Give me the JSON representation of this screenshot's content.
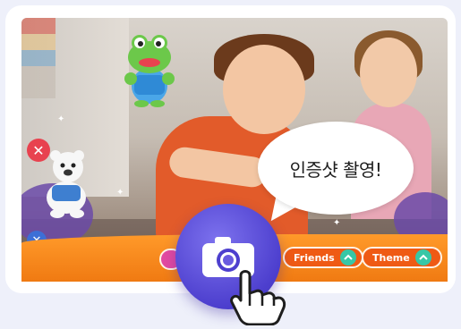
{
  "speech_bubble": {
    "text": "인증샷 촬영!"
  },
  "bottom_bar": {
    "friends_label": "Friends",
    "theme_label": "Theme"
  },
  "icons": {
    "camera": "camera-icon",
    "hand": "pointing-hand-icon",
    "close_red": "close-icon",
    "close_blue": "close-icon",
    "chevron": "chevron-up-icon"
  },
  "colors": {
    "accent_orange": "#f07a12",
    "camera_purple": "#4d3fce",
    "chevron_teal": "#37c7a6",
    "delete_red": "#e8424f",
    "delete_blue": "#3d6fd6"
  }
}
